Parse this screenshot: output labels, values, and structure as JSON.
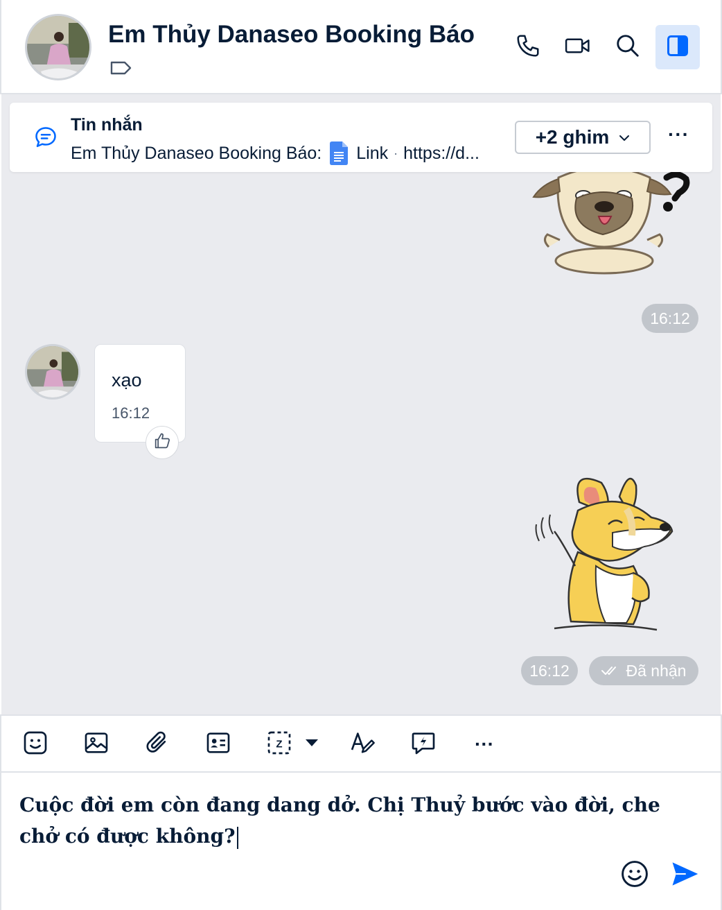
{
  "header": {
    "title": "Em Thủy Danaseo Booking Báo",
    "actions": [
      "phone-icon",
      "video-call-icon",
      "search-icon",
      "sidebar-toggle-icon"
    ]
  },
  "pinned": {
    "label": "Tin nhắn",
    "sender": "Em Thủy Danaseo Booking Báo:",
    "link_label": "Link",
    "link_url": "https://d...",
    "more_label": "+2 ghim",
    "menu_label": "···"
  },
  "messages": [
    {
      "type": "sticker",
      "direction": "outgoing",
      "sticker": "confused-pug-sticker",
      "time": "16:12"
    },
    {
      "type": "text",
      "direction": "incoming",
      "text": "xạo",
      "time": "16:12"
    },
    {
      "type": "sticker",
      "direction": "outgoing",
      "sticker": "smug-fox-sticker",
      "time": "16:12",
      "status": "Đã nhận"
    }
  ],
  "toolbar": {
    "items": [
      "sticker-icon",
      "image-icon",
      "attachment-icon",
      "contact-card-icon",
      "screenshot-icon",
      "format-text-icon",
      "quick-message-icon",
      "more-icon"
    ],
    "more_label": "···"
  },
  "composer": {
    "text": "Cuộc đời em còn đang dang dở. Chị Thuỷ bước vào đời, che chở có được không?"
  },
  "colors": {
    "accent": "#0068ff",
    "chat_bg": "#eaebef",
    "text": "#081c36",
    "time_pill": "#c1c5cb"
  }
}
